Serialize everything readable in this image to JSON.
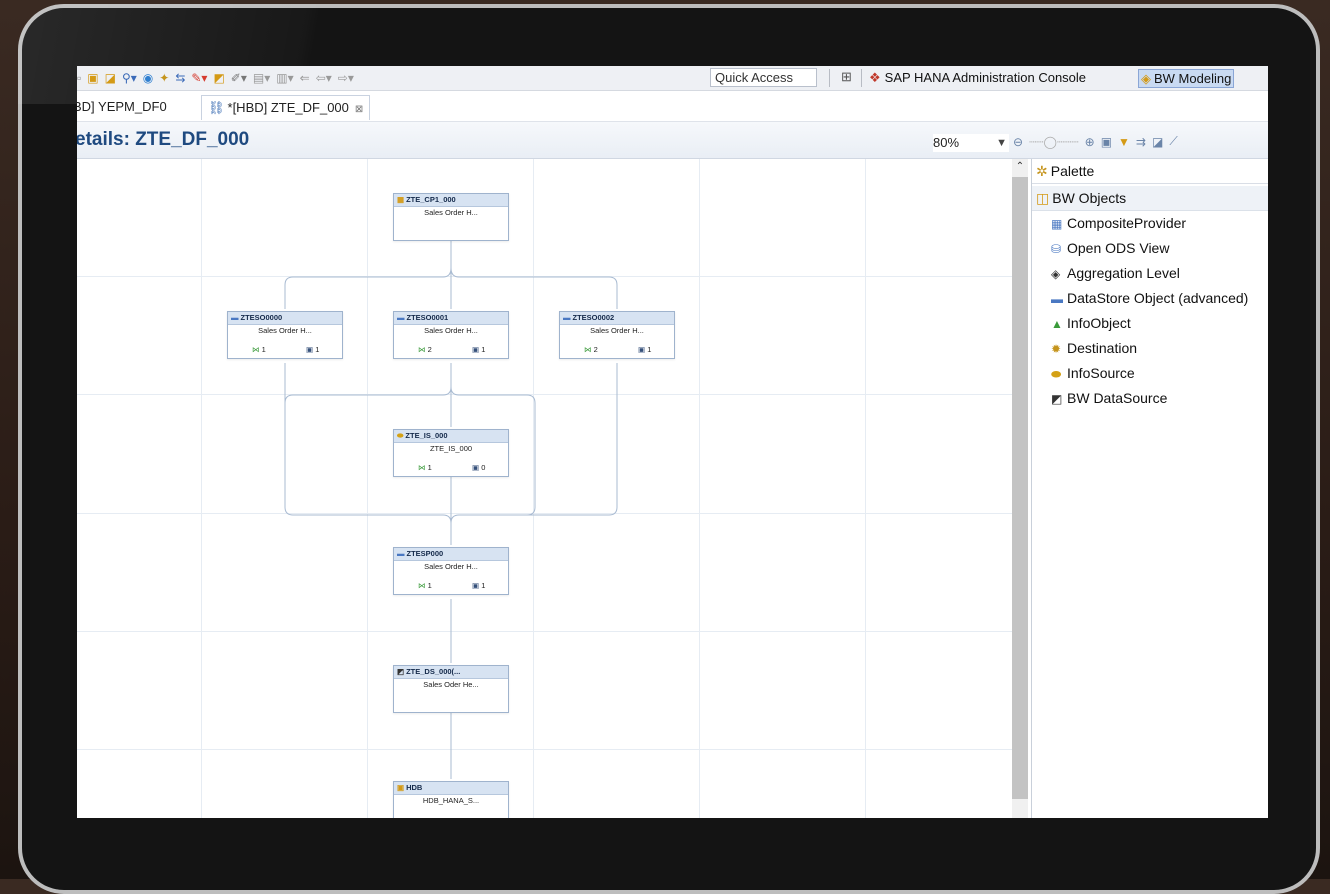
{
  "toolbar": {
    "quick_access": "Quick Access",
    "perspectives": [
      {
        "label": "SAP HANA Administration Console",
        "icon": "sap-hana-icon"
      },
      {
        "label": "BW Modeling",
        "icon": "bw-modeling-icon"
      }
    ]
  },
  "tabs": [
    {
      "label": "BD] YEPM_DF0",
      "active": false
    },
    {
      "label": "*[HBD] ZTE_DF_000",
      "active": true,
      "close": "⊠"
    }
  ],
  "editor": {
    "title": "etails: ZTE_DF_000",
    "zoom": "80%"
  },
  "nodes": [
    {
      "id": "n0",
      "name": "ZTE_CP1_000",
      "desc": "Sales Order H...",
      "icon": "composite-provider-icon",
      "left": null,
      "right": null
    },
    {
      "id": "n1",
      "name": "ZTESO0000",
      "desc": "Sales Order H...",
      "icon": "datastore-object-icon",
      "left": "1",
      "right": "1"
    },
    {
      "id": "n2",
      "name": "ZTESO0001",
      "desc": "Sales Order H...",
      "icon": "datastore-object-icon",
      "left": "2",
      "right": "1"
    },
    {
      "id": "n3",
      "name": "ZTESO0002",
      "desc": "Sales Order H...",
      "icon": "datastore-object-icon",
      "left": "2",
      "right": "1"
    },
    {
      "id": "n4",
      "name": "ZTE_IS_000",
      "desc": "ZTE_IS_000",
      "icon": "infosource-icon",
      "left": "1",
      "right": "0"
    },
    {
      "id": "n5",
      "name": "ZTESP000",
      "desc": "Sales Order H...",
      "icon": "datastore-object-icon",
      "left": "1",
      "right": "1"
    },
    {
      "id": "n6",
      "name": "ZTE_DS_000(...",
      "desc": "Sales Oder He...",
      "icon": "bw-datasource-icon",
      "left": null,
      "right": null
    },
    {
      "id": "n7",
      "name": "HDB",
      "desc": "HDB_HANA_S...",
      "icon": "source-system-icon",
      "left": null,
      "right": null
    }
  ],
  "palette": {
    "title": "Palette",
    "group": "BW Objects",
    "items": [
      {
        "label": "CompositeProvider",
        "icon": "composite-provider-icon",
        "color": "#4a78c2",
        "glyph": "▦"
      },
      {
        "label": "Open ODS View",
        "icon": "open-ods-view-icon",
        "color": "#4a78c2",
        "glyph": "⛁"
      },
      {
        "label": "Aggregation Level",
        "icon": "aggregation-level-icon",
        "color": "#333333",
        "glyph": "◈"
      },
      {
        "label": "DataStore Object (advanced)",
        "icon": "datastore-object-icon",
        "color": "#4a78c2",
        "glyph": "▬"
      },
      {
        "label": "InfoObject",
        "icon": "infoobject-icon",
        "color": "#3a9a3a",
        "glyph": "▲"
      },
      {
        "label": "Destination",
        "icon": "destination-icon",
        "color": "#c5941c",
        "glyph": "✹"
      },
      {
        "label": "InfoSource",
        "icon": "infosource-icon",
        "color": "#d4a116",
        "glyph": "⬬"
      },
      {
        "label": "BW DataSource",
        "icon": "bw-datasource-icon",
        "color": "#333333",
        "glyph": "◩"
      }
    ]
  }
}
